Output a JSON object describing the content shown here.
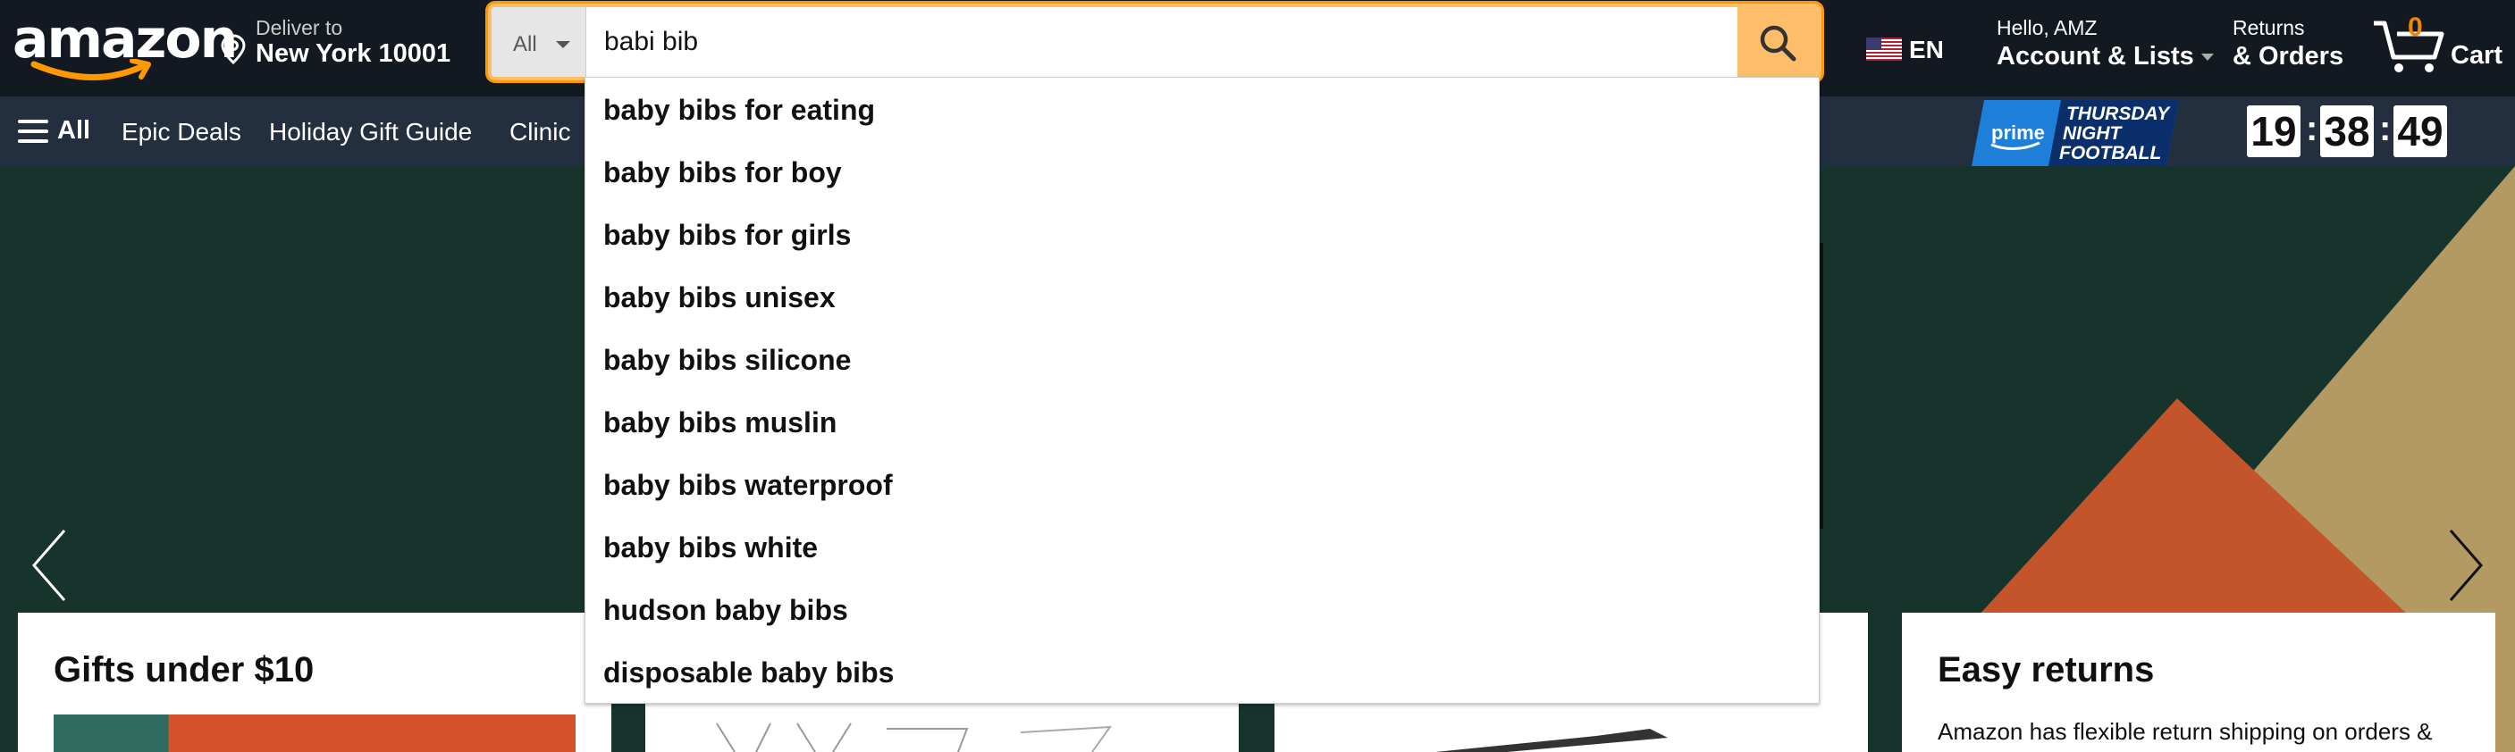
{
  "header": {
    "logo_text": "amazon",
    "deliver_label": "Deliver to",
    "deliver_location": "New York 10001",
    "search": {
      "category": "All",
      "query": "babi bib"
    },
    "language": "EN",
    "account_greeting": "Hello, AMZ",
    "account_label": "Account & Lists",
    "returns_label": "Returns",
    "orders_label": "& Orders",
    "cart_count": "0",
    "cart_label": "Cart"
  },
  "subnav": {
    "all_label": "All",
    "links": [
      "Epic Deals",
      "Holiday Gift Guide",
      "Clinic"
    ],
    "promo_brand": "prime",
    "promo_lines": [
      "THURSDAY",
      "NIGHT",
      "FOOTBALL"
    ],
    "timer": {
      "hours": "19",
      "minutes": "38",
      "seconds": "49"
    }
  },
  "suggestions": [
    "baby bibs for eating",
    "baby bibs for boy",
    "baby bibs for girls",
    "baby bibs unisex",
    "baby bibs silicone",
    "baby bibs muslin",
    "baby bibs waterproof",
    "baby bibs white",
    "hudson baby bibs",
    "disposable baby bibs"
  ],
  "cards": [
    {
      "title": "Gifts under $10"
    },
    {
      "title": ""
    },
    {
      "title": ""
    },
    {
      "title": "Easy returns",
      "subtitle": "Amazon has flexible return shipping on orders &"
    }
  ],
  "colors": {
    "nav_bg": "#131921",
    "subnav_bg": "#232f3e",
    "search_button": "#febd69",
    "search_focus": "#ff9900",
    "cart_count": "#f08804",
    "hero_bg": "#16332c"
  }
}
